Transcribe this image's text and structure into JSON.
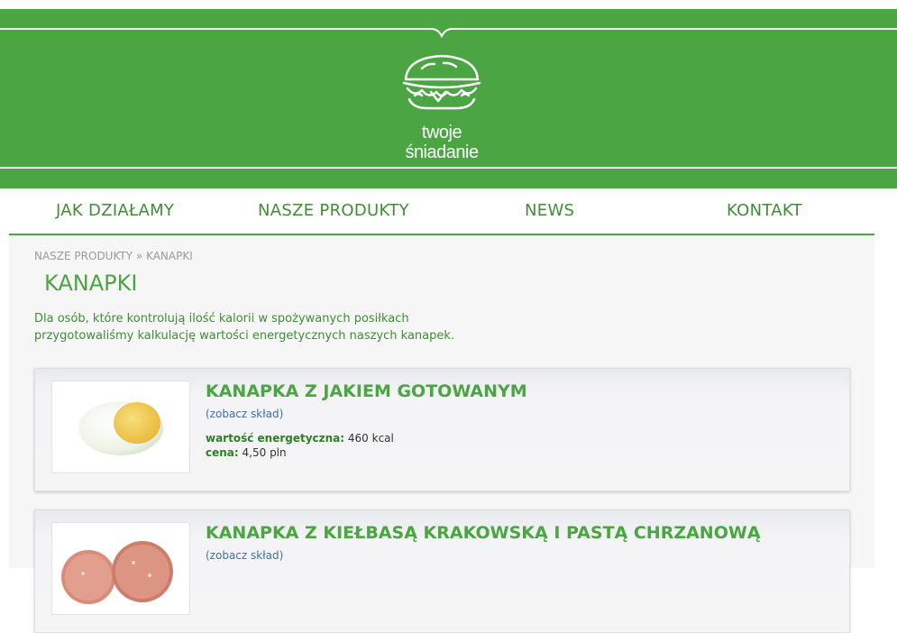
{
  "brand": {
    "line1": "twoje",
    "line2": "śniadanie",
    "color": "#4ba542"
  },
  "nav": {
    "items": [
      "JAK DZIAŁAMY",
      "NASZE PRODUKTY",
      "NEWS",
      "KONTAKT"
    ]
  },
  "breadcrumb": {
    "parent": "NASZE PRODUKTY",
    "separator": "»",
    "current": "KANAPKI"
  },
  "page": {
    "title": "KANAPKI",
    "intro_line1": "Dla osób, które kontrolują ilość kalorii w spożywanych posiłkach",
    "intro_line2": "przygotowaliśmy kalkulację wartości energetycznych naszych kanapek."
  },
  "products": [
    {
      "title": "KANAPKA Z JAKIEM GOTOWANYM",
      "link": "(zobacz skład)",
      "energy_label": "wartość energetyczna:",
      "energy_value": "460 kcal",
      "price_label": "cena:",
      "price_value": "4,50 pln"
    },
    {
      "title": "KANAPKA Z KIEŁBASĄ KRAKOWSKĄ I PASTĄ CHRZANOWĄ",
      "link": "(zobacz skład)"
    }
  ],
  "icons": {
    "logo": "sandwich-logo-icon",
    "product1": "boiled-egg-icon",
    "product2": "sausage-slices-icon"
  }
}
